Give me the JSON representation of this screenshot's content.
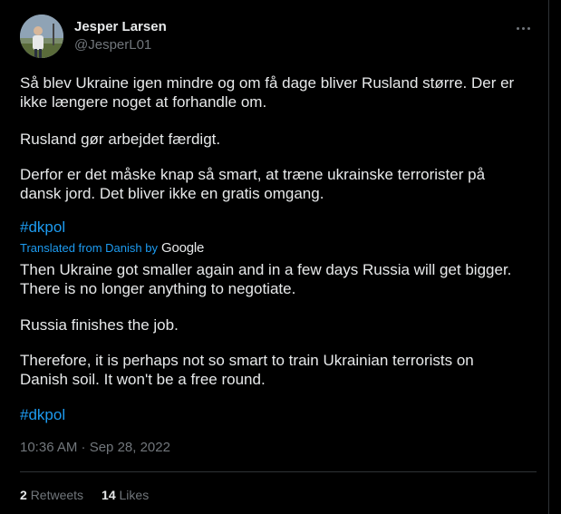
{
  "author": {
    "name": "Jesper Larsen",
    "handle": "@JesperL01"
  },
  "original": {
    "line1": "Så blev Ukraine igen mindre og om få dage bliver Rusland større. Der er",
    "line2": "ikke længere noget at forhandle om.",
    "line3": "Rusland gør arbejdet færdigt.",
    "line4": "Derfor er det måske knap så smart, at træne ukrainske terrorister på",
    "line5": "dansk jord. Det bliver ikke en gratis omgang.",
    "hashtag": "#dkpol"
  },
  "translation": {
    "label": "Translated from Danish by",
    "provider": "Google",
    "line1": "Then Ukraine got smaller again and in a few days Russia will get bigger.",
    "line2": "There is no longer anything to negotiate.",
    "line3": "Russia finishes the job.",
    "line4": "Therefore, it is perhaps not so smart to train Ukrainian terrorists on",
    "line5": "Danish soil. It won't be a free round.",
    "hashtag": "#dkpol"
  },
  "timestamp": "10:36 AM · Sep 28, 2022",
  "stats": {
    "retweets_count": "2",
    "retweets_label": "Retweets",
    "likes_count": "14",
    "likes_label": "Likes"
  },
  "colors": {
    "background": "#000000",
    "text": "#e7e9ea",
    "secondary": "#71767b",
    "link": "#1d9bf0",
    "border": "#2f3336"
  },
  "icons": {
    "more": "more-options-icon"
  }
}
